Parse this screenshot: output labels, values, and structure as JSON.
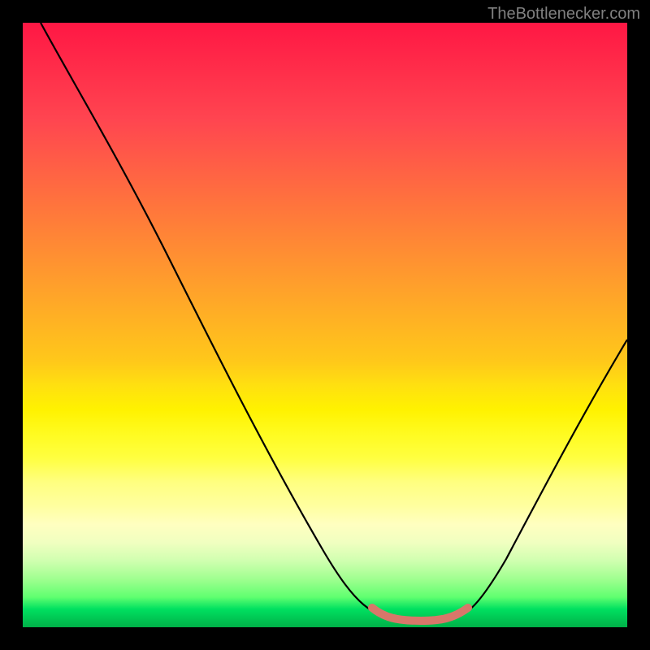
{
  "watermark": "TheBottlenecker.com",
  "chart_data": {
    "type": "line",
    "title": "",
    "xlabel": "",
    "ylabel": "",
    "xlim": [
      0,
      100
    ],
    "ylim": [
      0,
      100
    ],
    "series": [
      {
        "name": "curve",
        "color": "#000000",
        "x": [
          3,
          10,
          20,
          30,
          40,
          50,
          57,
          60,
          63,
          66,
          69,
          72,
          75,
          80,
          85,
          90,
          95,
          100
        ],
        "values": [
          100,
          88,
          71,
          54,
          37,
          20,
          8,
          4,
          2,
          1.5,
          1.5,
          2,
          4,
          10,
          20,
          32,
          44,
          55
        ]
      },
      {
        "name": "bottom-marker",
        "color": "#d8776a",
        "x": [
          58,
          60,
          62,
          64,
          66,
          68,
          70,
          72,
          74
        ],
        "values": [
          3.5,
          2.2,
          1.7,
          1.5,
          1.5,
          1.6,
          1.9,
          2.4,
          3.8
        ]
      }
    ],
    "background_gradient": {
      "top": "#ff1744",
      "mid_upper": "#ff9430",
      "mid": "#ffe010",
      "mid_lower": "#ffff80",
      "bottom": "#00c050"
    }
  }
}
